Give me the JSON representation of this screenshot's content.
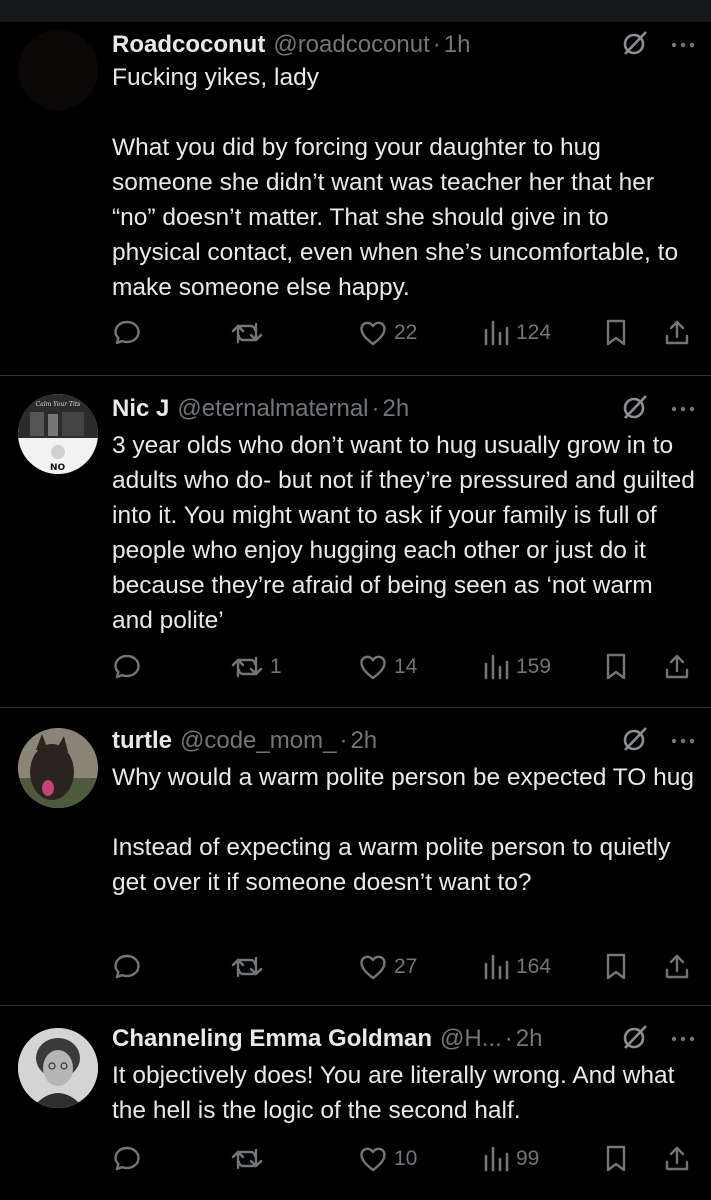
{
  "tweets": [
    {
      "name": "Roadcoconut",
      "handle": "@roadcoconut",
      "time": "1h",
      "text": "Fucking yikes, lady\n\nWhat you did by forcing your daughter to hug someone she didn’t want was teacher her that her “no” doesn’t matter. That she should give in to physical contact, even when she’s uncomfortable, to make someone else happy.",
      "replies": "",
      "retweets": "",
      "likes": "22",
      "views": "124"
    },
    {
      "name": "Nic J",
      "handle": "@eternalmaternal",
      "time": "2h",
      "text": "3 year olds who don’t want to hug usually grow in to adults who do- but not if they’re pressured and guilted into it. You might want to ask if your family is full of people who enjoy hugging each other or just do it because they’re afraid of being seen as ‘not warm and polite’",
      "avatar_text_top": "Calm Your Tits",
      "avatar_text_bottom": "NO",
      "replies": "",
      "retweets": "1",
      "likes": "14",
      "views": "159"
    },
    {
      "name": "turtle",
      "handle": "@code_mom_",
      "time": "2h",
      "text": "Why would a warm polite person be expected TO hug\n\nInstead of expecting a warm polite person to quietly get over it if someone doesn’t want to?",
      "replies": "",
      "retweets": "",
      "likes": "27",
      "views": "164"
    },
    {
      "name": "Channeling Emma Goldman",
      "handle": "@H...",
      "time": "2h",
      "text": "It objectively does! You are literally wrong. And what the hell is the logic of the second half.",
      "replies": "",
      "retweets": "",
      "likes": "10",
      "views": "99"
    }
  ],
  "separator": "·",
  "icons": {
    "grok": "grok-slash-icon",
    "more": "more-horizontal-icon",
    "reply": "reply-bubble-icon",
    "retweet": "retweet-icon",
    "like": "heart-icon",
    "views": "views-bars-icon",
    "bookmark": "bookmark-icon",
    "share": "share-icon"
  },
  "colors": {
    "background": "#000000",
    "text": "#e7e9ea",
    "muted": "#71767b",
    "divider": "#2f3336"
  }
}
